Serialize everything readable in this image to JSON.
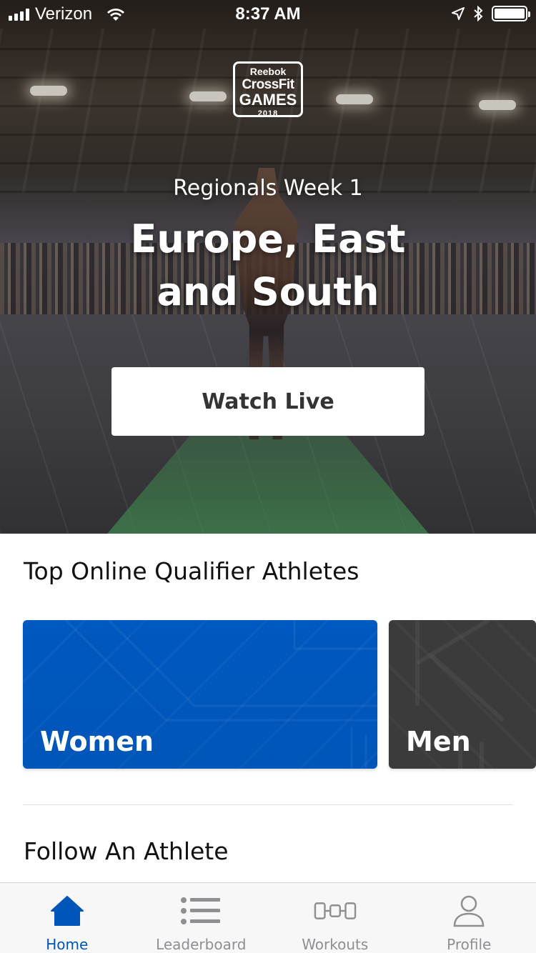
{
  "status_bar": {
    "carrier": "Verizon",
    "time": "8:37 AM"
  },
  "hero": {
    "logo": {
      "line1": "Reebok",
      "line2": "CrossFit",
      "line3": "GAMES",
      "line4": "2018"
    },
    "subtitle": "Regionals Week 1",
    "title_line1": "Europe, East",
    "title_line2": "and South",
    "watch_button": "Watch Live"
  },
  "athletes_section": {
    "title": "Top Online Qualifier Athletes",
    "cards": [
      {
        "label": "Women",
        "color": "#0055b8"
      },
      {
        "label": "Men",
        "color": "#3b3b3b"
      }
    ]
  },
  "follow_section": {
    "title": "Follow An Athlete"
  },
  "tab_bar": {
    "active_color": "#0055b8",
    "tabs": [
      {
        "label": "Home",
        "icon": "home-icon",
        "active": true
      },
      {
        "label": "Leaderboard",
        "icon": "list-icon",
        "active": false
      },
      {
        "label": "Workouts",
        "icon": "barbell-icon",
        "active": false
      },
      {
        "label": "Profile",
        "icon": "person-icon",
        "active": false
      }
    ]
  }
}
